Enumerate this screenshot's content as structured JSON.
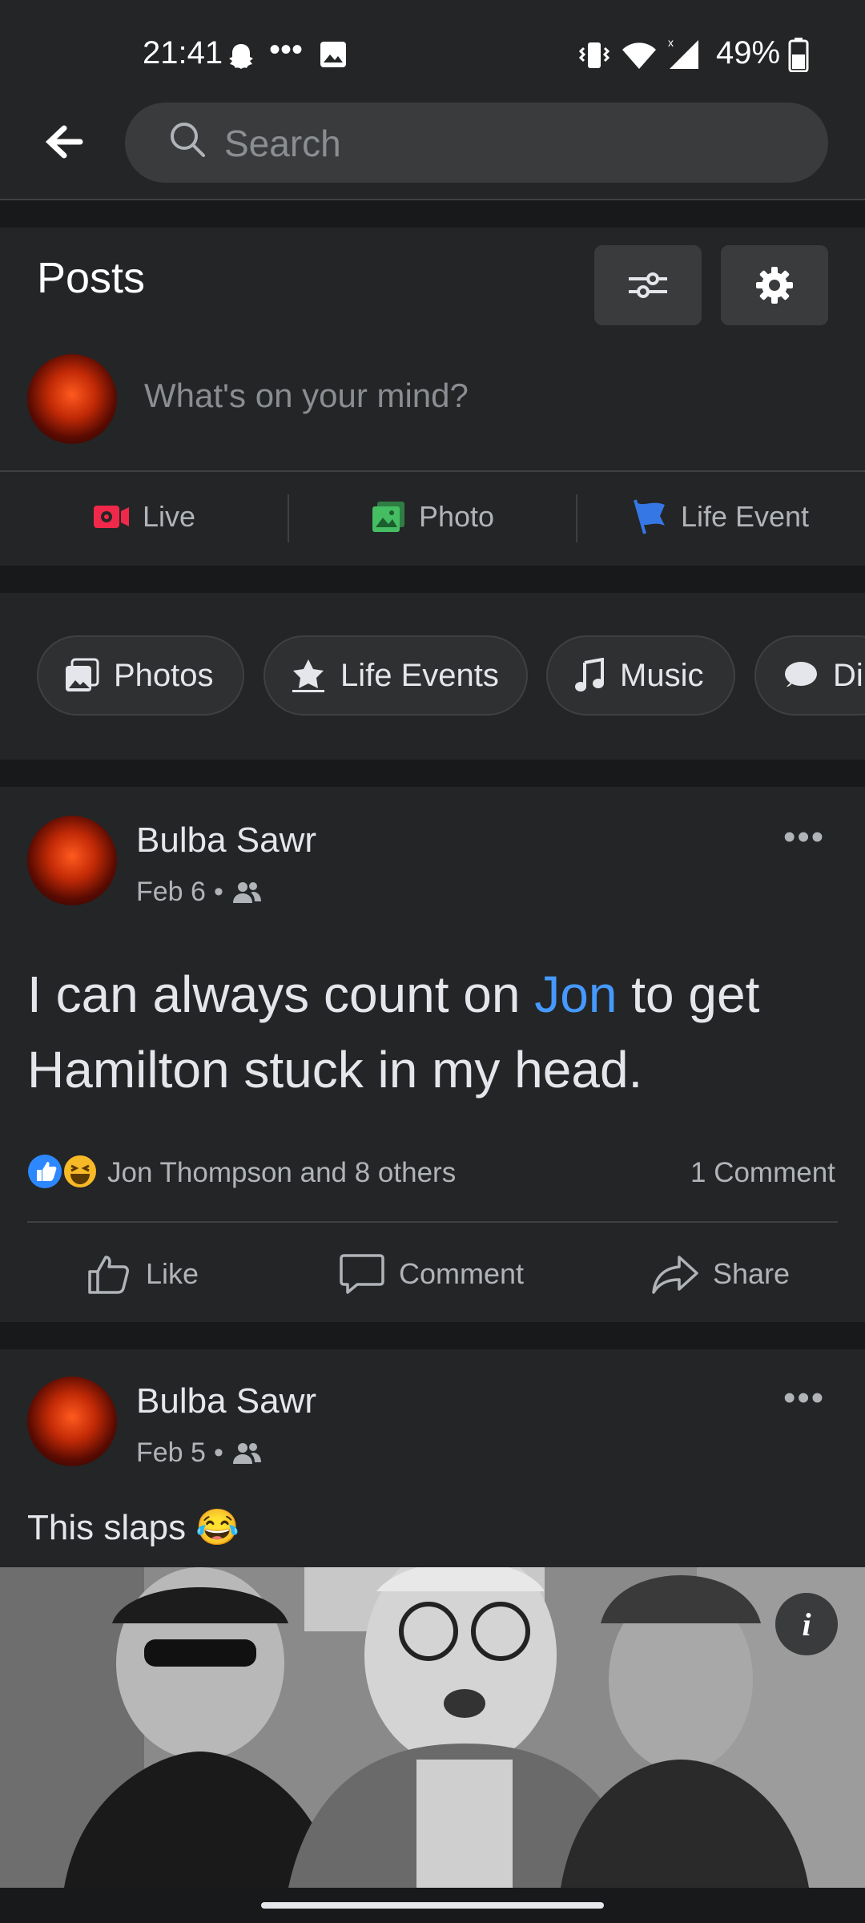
{
  "status_bar": {
    "time": "21:41",
    "battery": "49%"
  },
  "search": {
    "placeholder": "Search"
  },
  "posts_section": {
    "title": "Posts",
    "composer_prompt": "What's on your mind?"
  },
  "composer_actions": [
    {
      "label": "Live",
      "icon": "live-video-icon",
      "color": "#f02849"
    },
    {
      "label": "Photo",
      "icon": "photo-icon",
      "color": "#45bd62"
    },
    {
      "label": "Life Event",
      "icon": "flag-icon",
      "color": "#3578e5"
    }
  ],
  "filter_chips": [
    {
      "label": "Photos",
      "icon": "photos-icon"
    },
    {
      "label": "Life Events",
      "icon": "star-icon"
    },
    {
      "label": "Music",
      "icon": "music-note-icon"
    },
    {
      "label": "Di",
      "icon": "chat-bubble-icon"
    }
  ],
  "post1": {
    "author": "Bulba Sawr",
    "date": "Feb 6",
    "separator": "•",
    "text_before": "I can always count on ",
    "mention": "Jon",
    "text_after": " to get Hamilton stuck in my head.",
    "reactions_text": "Jon Thompson and 8 others",
    "comments_text": "1 Comment",
    "actions": {
      "like": "Like",
      "comment": "Comment",
      "share": "Share"
    }
  },
  "post2": {
    "author": "Bulba Sawr",
    "date": "Feb 5",
    "separator": "•",
    "text": "This slaps 😂",
    "info_glyph": "i"
  },
  "colors": {
    "background": "#18191a",
    "card": "#242526",
    "accent_link": "#4599ff"
  }
}
